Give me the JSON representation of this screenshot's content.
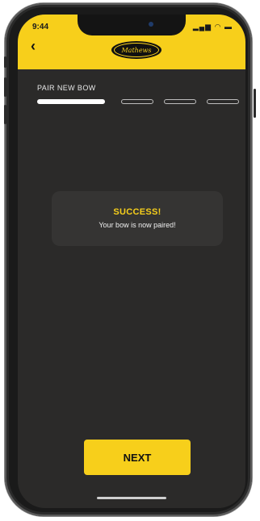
{
  "status_bar": {
    "time": "9:44",
    "icons": "..ll ≈ ■"
  },
  "header": {
    "back_icon": "chevron-left-icon",
    "logo_text": "Mathews",
    "accent": "#f7cf1b"
  },
  "pairing": {
    "title": "PAIR NEW BOW",
    "steps": 4,
    "current_step": 1
  },
  "toast": {
    "title": "SUCCESS!",
    "message": "Your bow is now paired!"
  },
  "actions": {
    "next_label": "NEXT"
  },
  "colors": {
    "background": "#2b2a29",
    "card": "#353433",
    "accent": "#f7cf1b"
  }
}
